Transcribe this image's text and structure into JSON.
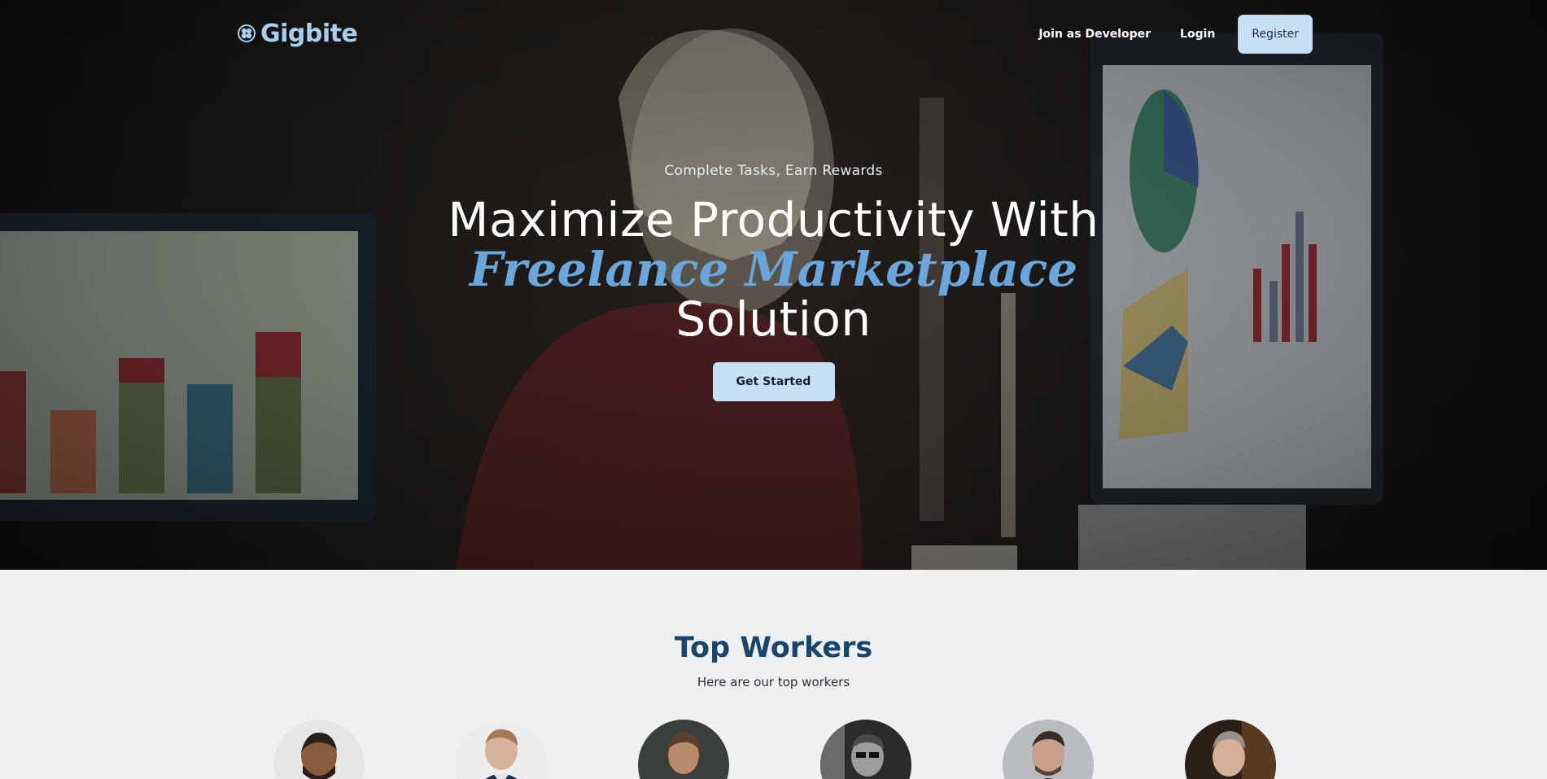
{
  "brand": {
    "name": "Gigbite",
    "accent": "#a9cdef"
  },
  "nav": {
    "links": [
      {
        "label": "Join as Developer"
      },
      {
        "label": "Login"
      }
    ],
    "register_label": "Register"
  },
  "hero": {
    "eyebrow": "Complete Tasks, Earn Rewards",
    "headline_line1": "Maximize Productivity With",
    "headline_accent": "Freelance Marketplace",
    "headline_line3": "Solution",
    "cta_label": "Get Started",
    "accent_color": "#6aa6db",
    "button_color": "#c7dff6"
  },
  "workers": {
    "title": "Top Workers",
    "subtitle": "Here are our top workers",
    "title_color": "#17456b",
    "avatars": [
      {
        "icon": "worker-avatar-1"
      },
      {
        "icon": "worker-avatar-2"
      },
      {
        "icon": "worker-avatar-3"
      },
      {
        "icon": "worker-avatar-4"
      },
      {
        "icon": "worker-avatar-5"
      },
      {
        "icon": "worker-avatar-6"
      }
    ]
  }
}
